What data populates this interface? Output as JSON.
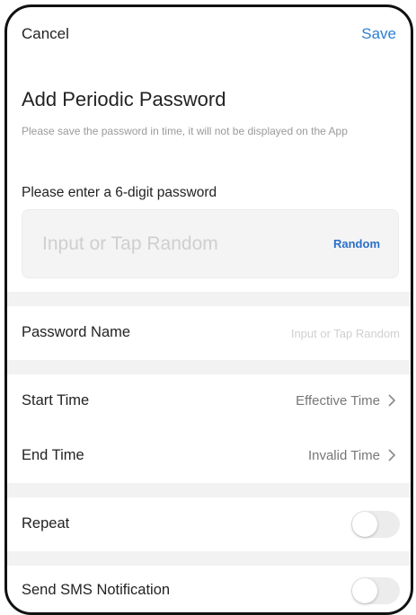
{
  "header": {
    "cancel_label": "Cancel",
    "save_label": "Save"
  },
  "title": "Add Periodic Password",
  "subtitle": "Please save the password in time, it will not be displayed on the App",
  "password": {
    "prompt": "Please enter a 6-digit password",
    "placeholder": "Input or Tap Random",
    "random_label": "Random"
  },
  "password_name": {
    "label": "Password Name",
    "placeholder": "Input or Tap Random"
  },
  "start_time": {
    "label": "Start Time",
    "value": "Effective Time",
    "icon": "chevron-right-icon"
  },
  "end_time": {
    "label": "End Time",
    "value": "Invalid Time",
    "icon": "chevron-right-icon"
  },
  "repeat": {
    "label": "Repeat",
    "enabled": false
  },
  "sms": {
    "label": "Send SMS Notification",
    "enabled": false
  },
  "colors": {
    "accent": "#2b7fd4",
    "random": "#2b6fc9",
    "divider": "#f2f2f2",
    "toggle_off": "#ececec"
  }
}
